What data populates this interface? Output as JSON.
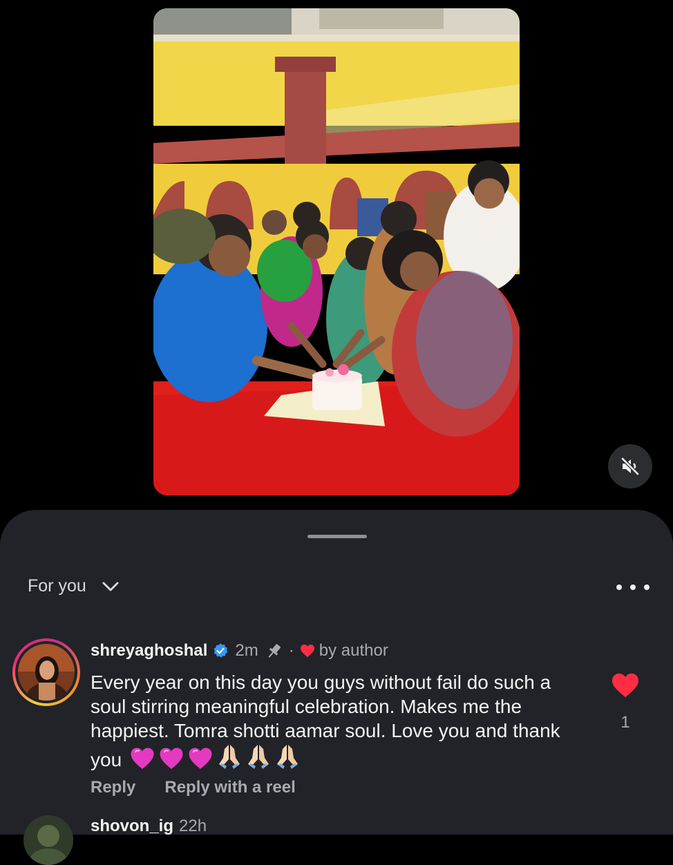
{
  "video": {
    "mute_icon": "speaker-muted-icon"
  },
  "sheet": {
    "filter_label": "For you",
    "more_icon": "more-horizontal-icon"
  },
  "comments": [
    {
      "username": "shreyaghoshal",
      "verified": true,
      "time": "2m",
      "pinned": true,
      "separator": "·",
      "liked_by_author_label": "by author",
      "text": "Every year on this day you guys without fail do such a soul stirring meaningful celebration. Makes me the happiest. Tomra shotti aamar soul. Love you and thank you",
      "emojis": [
        "pink-heart",
        "pink-heart",
        "pink-heart",
        "folded-hands",
        "folded-hands",
        "folded-hands"
      ],
      "like_count": "1",
      "liked": true,
      "reply_label": "Reply",
      "reply_reel_label": "Reply with a reel"
    },
    {
      "username": "shovon_ig",
      "time": "22h"
    }
  ],
  "colors": {
    "background": "#000000",
    "sheet": "#212328",
    "like_red": "#ff2d43",
    "verified_blue": "#3897f0",
    "muted_text": "#a8aab0"
  }
}
